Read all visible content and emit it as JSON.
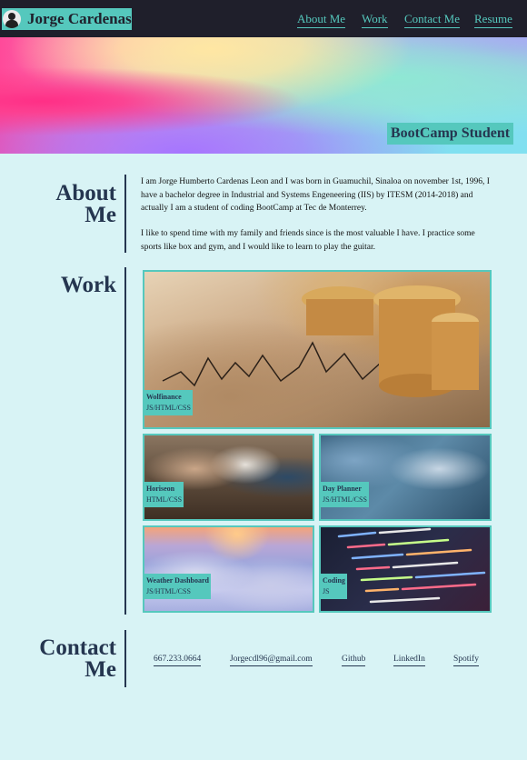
{
  "nav": {
    "brand": "Jorge Cardenas",
    "links": [
      "About Me",
      "Work",
      "Contact Me",
      "Resume"
    ]
  },
  "hero": {
    "badge": "BootCamp Student"
  },
  "about": {
    "title_line1": "About",
    "title_line2": "Me",
    "paragraph1": "I am Jorge Humberto Cardenas Leon and I was born in Guamuchil, Sinaloa on november 1st, 1996, I have a bachelor degree in Industrial and Systems Engeneering (IIS) by ITESM (2014-2018) and actually I am a student of coding BootCamp at Tec de Monterrey.",
    "paragraph2": "I like to spend time with my family and friends since is the most valuable I have. I practice some sports like box and gym, and I would like to learn to play the guitar."
  },
  "work": {
    "title": "Work",
    "projects": [
      {
        "name": "Wolfinance",
        "tech": "JS/HTML/CSS"
      },
      {
        "name": "Horiseon",
        "tech": "HTML/CSS"
      },
      {
        "name": "Day Planner",
        "tech": "JS/HTML/CSS"
      },
      {
        "name": "Weather Dashboard",
        "tech": "JS/HTML/CSS"
      },
      {
        "name": "Coding",
        "tech": "JS"
      }
    ]
  },
  "contact": {
    "title_line1": "Contact",
    "title_line2": "Me",
    "links": [
      "667.233.0664",
      "Jorgecdl96@gmail.com",
      "Github",
      "LinkedIn",
      "Spotify"
    ]
  },
  "colors": {
    "nav_bg": "#1f1f2b",
    "accent": "#55c8bd",
    "page_bg": "#d8f3f5",
    "heading": "#253650"
  }
}
